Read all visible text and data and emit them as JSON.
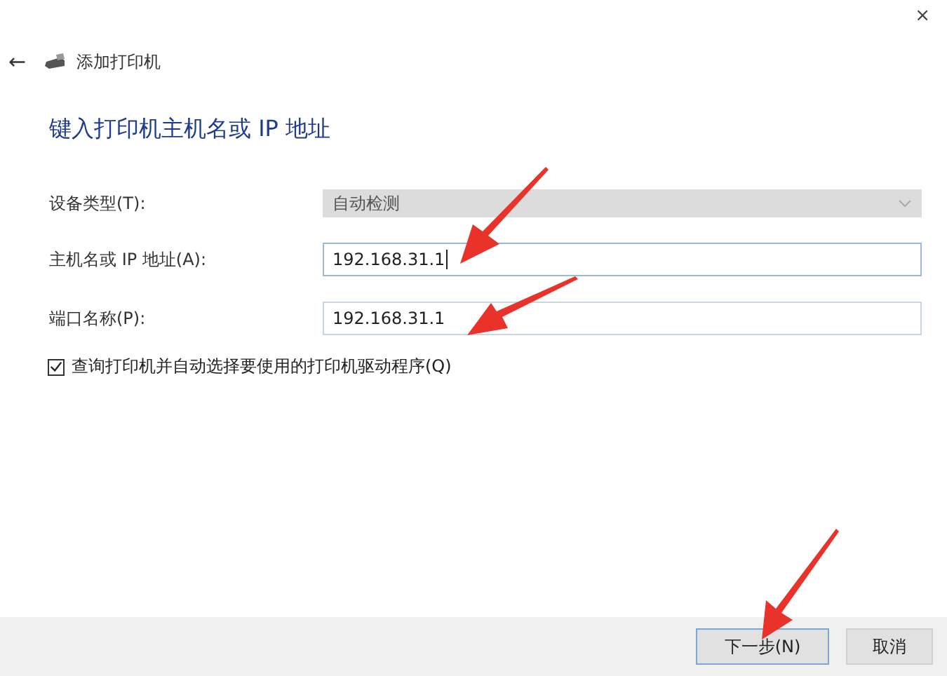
{
  "window": {
    "close": "×"
  },
  "header": {
    "back": "←",
    "title": "添加打印机"
  },
  "heading": "键入打印机主机名或 IP 地址",
  "fields": [
    {
      "kind": "dropdown",
      "label": "设备类型(T):",
      "value": "自动检测",
      "disabled": true
    },
    {
      "kind": "text",
      "label": "主机名或 IP 地址(A):",
      "value": "192.168.31.1",
      "focused": true
    },
    {
      "kind": "text",
      "label": "端口名称(P):",
      "value": "192.168.31.1",
      "focused": false
    }
  ],
  "checkbox": {
    "label": "查询打印机并自动选择要使用的打印机驱动程序(Q)",
    "checked": true
  },
  "buttons": [
    {
      "label": "下一步(N)",
      "primary": true
    },
    {
      "label": "取消",
      "primary": false
    }
  ]
}
